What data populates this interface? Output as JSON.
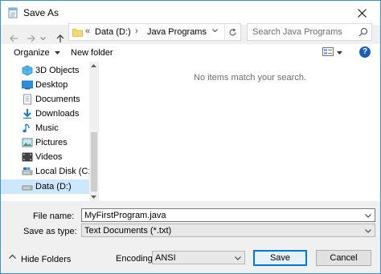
{
  "window": {
    "title": "Save As"
  },
  "address": {
    "overflow": "«",
    "crumbs": [
      "Data (D:)",
      "Java Programs"
    ],
    "separator": "›"
  },
  "search": {
    "placeholder": "Search Java Programs"
  },
  "toolbar": {
    "organize": "Organize",
    "new_folder": "New folder",
    "help": "?"
  },
  "nav_pane": {
    "items": [
      {
        "label": "3D Objects",
        "icon": "3d-objects-icon"
      },
      {
        "label": "Desktop",
        "icon": "desktop-icon"
      },
      {
        "label": "Documents",
        "icon": "documents-icon"
      },
      {
        "label": "Downloads",
        "icon": "downloads-icon"
      },
      {
        "label": "Music",
        "icon": "music-icon"
      },
      {
        "label": "Pictures",
        "icon": "pictures-icon"
      },
      {
        "label": "Videos",
        "icon": "videos-icon"
      },
      {
        "label": "Local Disk (C:)",
        "icon": "local-disk-icon"
      },
      {
        "label": "Data (D:)",
        "icon": "drive-icon",
        "selected": true
      }
    ]
  },
  "content": {
    "empty_message": "No items match your search."
  },
  "form": {
    "file_name_label": "File name:",
    "file_name_value": "MyFirstProgram.java",
    "save_type_label": "Save as type:",
    "save_type_value": "Text Documents (*.txt)",
    "encoding_label": "Encoding:",
    "encoding_value": "ANSI"
  },
  "footer": {
    "hide_folders": "Hide Folders",
    "save": "Save",
    "cancel": "Cancel"
  },
  "colors": {
    "accent": "#0078d7",
    "selected": "#cce8ff",
    "border": "#3c8fd9"
  }
}
